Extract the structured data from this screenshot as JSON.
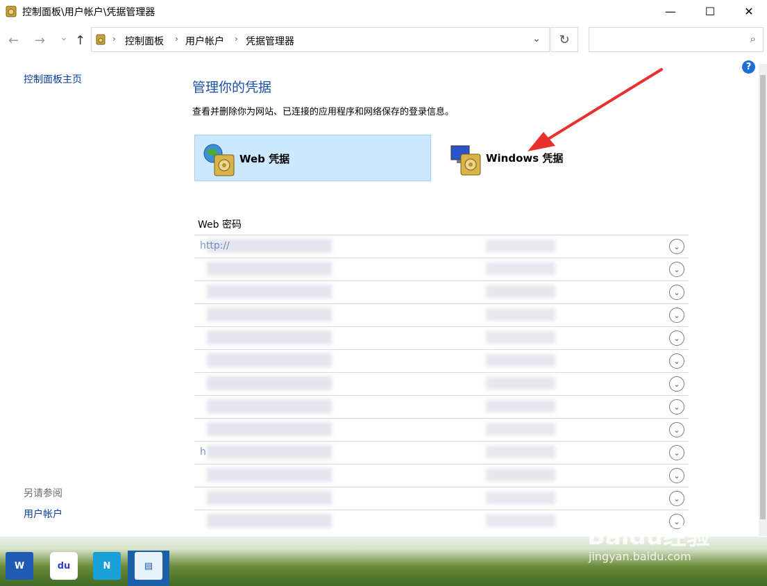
{
  "window": {
    "title": "控制面板\\用户帐户\\凭据管理器",
    "minimize": "—",
    "maximize": "☐",
    "close": "✕"
  },
  "nav": {
    "back": "←",
    "forward": "→",
    "recent": "⌄",
    "up": "↑",
    "breadcrumbs": [
      "控制面板",
      "用户帐户",
      "凭据管理器"
    ],
    "separator": "›",
    "dropdown": "⌄",
    "refresh": "↻",
    "search_placeholder": "",
    "search_icon": "⌕"
  },
  "help": {
    "label": "?"
  },
  "sidebar": {
    "home_link": "控制面板主页",
    "see_also_heading": "另请参阅",
    "see_also_link": "用户帐户"
  },
  "main": {
    "title": "管理你的凭据",
    "description": "查看并删除你为网站、已连接的应用程序和网络保存的登录信息。",
    "tiles": [
      {
        "label": "Web 凭据",
        "icon": "web-credentials-icon",
        "selected": true
      },
      {
        "label": "Windows 凭据",
        "icon": "windows-credentials-icon",
        "selected": false
      }
    ],
    "section_label": "Web 密码",
    "rows": [
      {
        "text": "http://"
      },
      {
        "text": ""
      },
      {
        "text": ""
      },
      {
        "text": ""
      },
      {
        "text": ""
      },
      {
        "text": ""
      },
      {
        "text": ""
      },
      {
        "text": ""
      },
      {
        "text": ""
      },
      {
        "text": "h"
      },
      {
        "text": ""
      },
      {
        "text": ""
      },
      {
        "text": ""
      }
    ],
    "expand_icon": "⌄"
  },
  "taskbar": {
    "apps": [
      {
        "name": "word",
        "label": "W"
      },
      {
        "name": "baidu",
        "label": "du"
      },
      {
        "name": "app3",
        "label": "N"
      },
      {
        "name": "control-panel",
        "label": "▤"
      }
    ]
  },
  "watermark": {
    "line1": "Baidu经验",
    "line2": "jingyan.baidu.com"
  },
  "colors": {
    "accent": "#1e4fa3",
    "selected_tile": "#cce8ff",
    "annotation_arrow": "#e8302e"
  }
}
